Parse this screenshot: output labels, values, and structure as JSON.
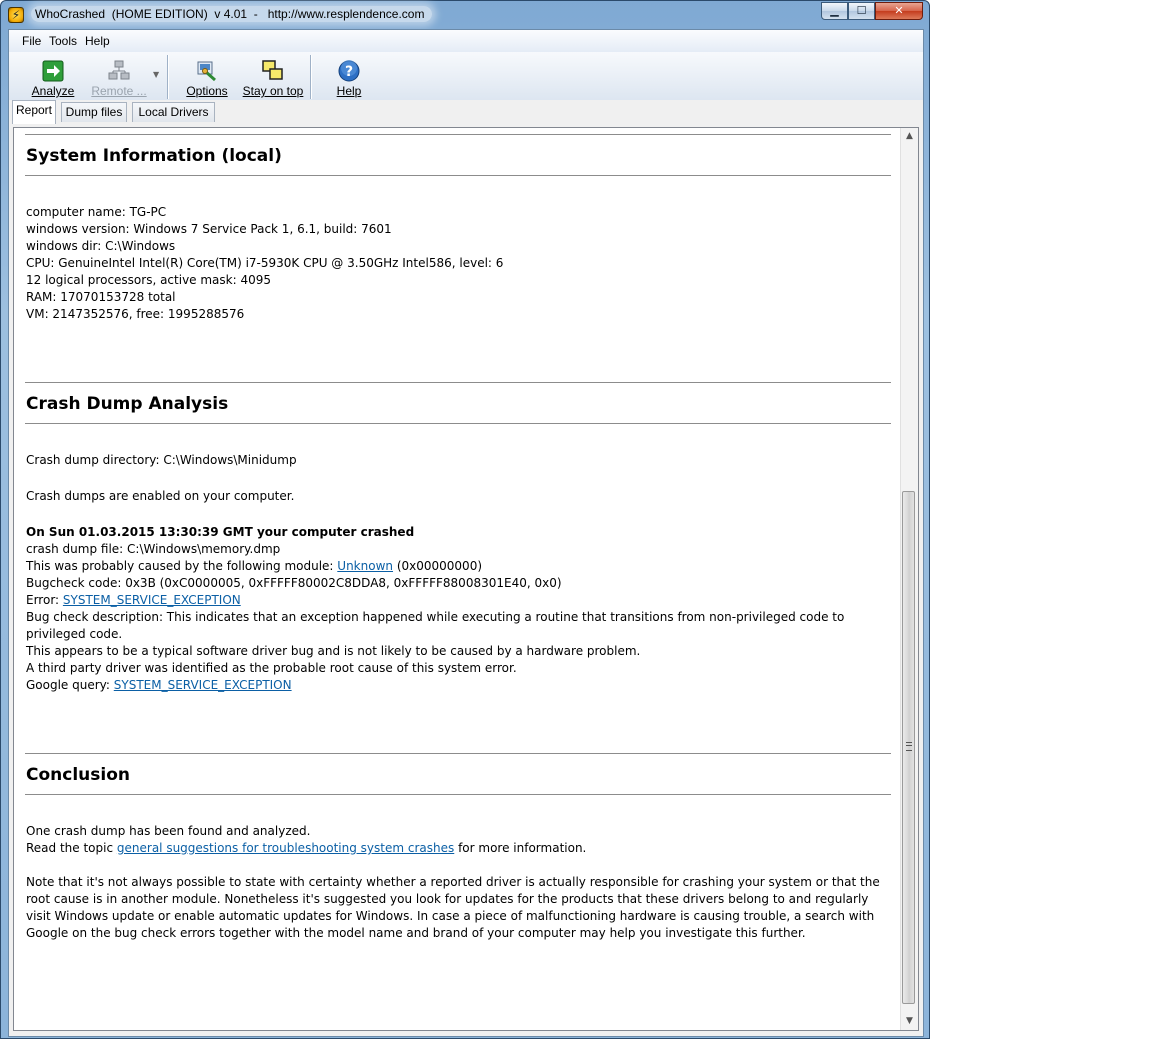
{
  "window": {
    "title": "WhoCrashed  (HOME EDITION)  v 4.01  -   http://www.resplendence.com",
    "min_symbol": "▁",
    "max_symbol": "☐",
    "close_symbol": "✕"
  },
  "menu": [
    "File",
    "Tools",
    "Help"
  ],
  "toolbar": {
    "analyze": "Analyze",
    "remote": "Remote ...",
    "options": "Options",
    "stay_on_top": "Stay on top",
    "help": "Help"
  },
  "tabs": [
    "Report",
    "Dump files",
    "Local Drivers"
  ],
  "report": {
    "sysinfo": {
      "heading": "System Information (local)",
      "lines": [
        "computer name: TG-PC",
        "windows version: Windows 7 Service Pack 1, 6.1, build: 7601",
        "windows dir: C:\\Windows",
        "CPU: GenuineIntel Intel(R) Core(TM) i7-5930K CPU @ 3.50GHz Intel586, level: 6",
        "12 logical processors, active mask: 4095",
        "RAM: 17070153728 total",
        "VM: 2147352576, free: 1995288576"
      ]
    },
    "crash": {
      "heading": "Crash Dump Analysis",
      "dir": "Crash dump directory: C:\\Windows\\Minidump",
      "enabled": "Crash dumps are enabled on your computer.",
      "event_title": "On Sun 01.03.2015 13:30:39 GMT your computer crashed",
      "dump_file": "crash dump file: C:\\Windows\\memory.dmp",
      "module_prefix": "This was probably caused by the following module: ",
      "module_link": "Unknown",
      "module_suffix": " (0x00000000)",
      "bugcheck": "Bugcheck code: 0x3B (0xC0000005, 0xFFFFF80002C8DDA8, 0xFFFFF88008301E40, 0x0)",
      "error_prefix": "Error: ",
      "error_link": "SYSTEM_SERVICE_EXCEPTION",
      "desc": "Bug check description: This indicates that an exception happened while executing a routine that transitions from non-privileged code to privileged code.",
      "typical": "This appears to be a typical software driver bug and is not likely to be caused by a hardware problem.",
      "third_party": "A third party driver was identified as the probable root cause of this system error.",
      "google_prefix": "Google query: ",
      "google_link": "SYSTEM_SERVICE_EXCEPTION"
    },
    "conclusion": {
      "heading": "Conclusion",
      "found": "One crash dump has been found and analyzed.",
      "topic_prefix": "Read the topic ",
      "topic_link": "general suggestions for troubleshooting system crashes",
      "topic_suffix": " for more information.",
      "note": "Note that it's not always possible to state with certainty whether a reported driver is actually responsible for crashing your system or that the root cause is in another module. Nonetheless it's suggested you look for updates for the products that these drivers belong to and regularly visit Windows update or enable automatic updates for Windows. In case a piece of malfunctioning hardware is causing trouble, a search with Google on the bug check errors together with the model name and brand of your computer may help you investigate this further."
    }
  },
  "scrollbar": {
    "up": "▲",
    "down": "▼"
  },
  "icons": {
    "app": "lightning-icon",
    "analyze": "green-arrow-icon",
    "remote": "network-computers-icon",
    "options": "options-icon",
    "stay_on_top": "windows-stack-icon",
    "help": "help-question-icon"
  }
}
